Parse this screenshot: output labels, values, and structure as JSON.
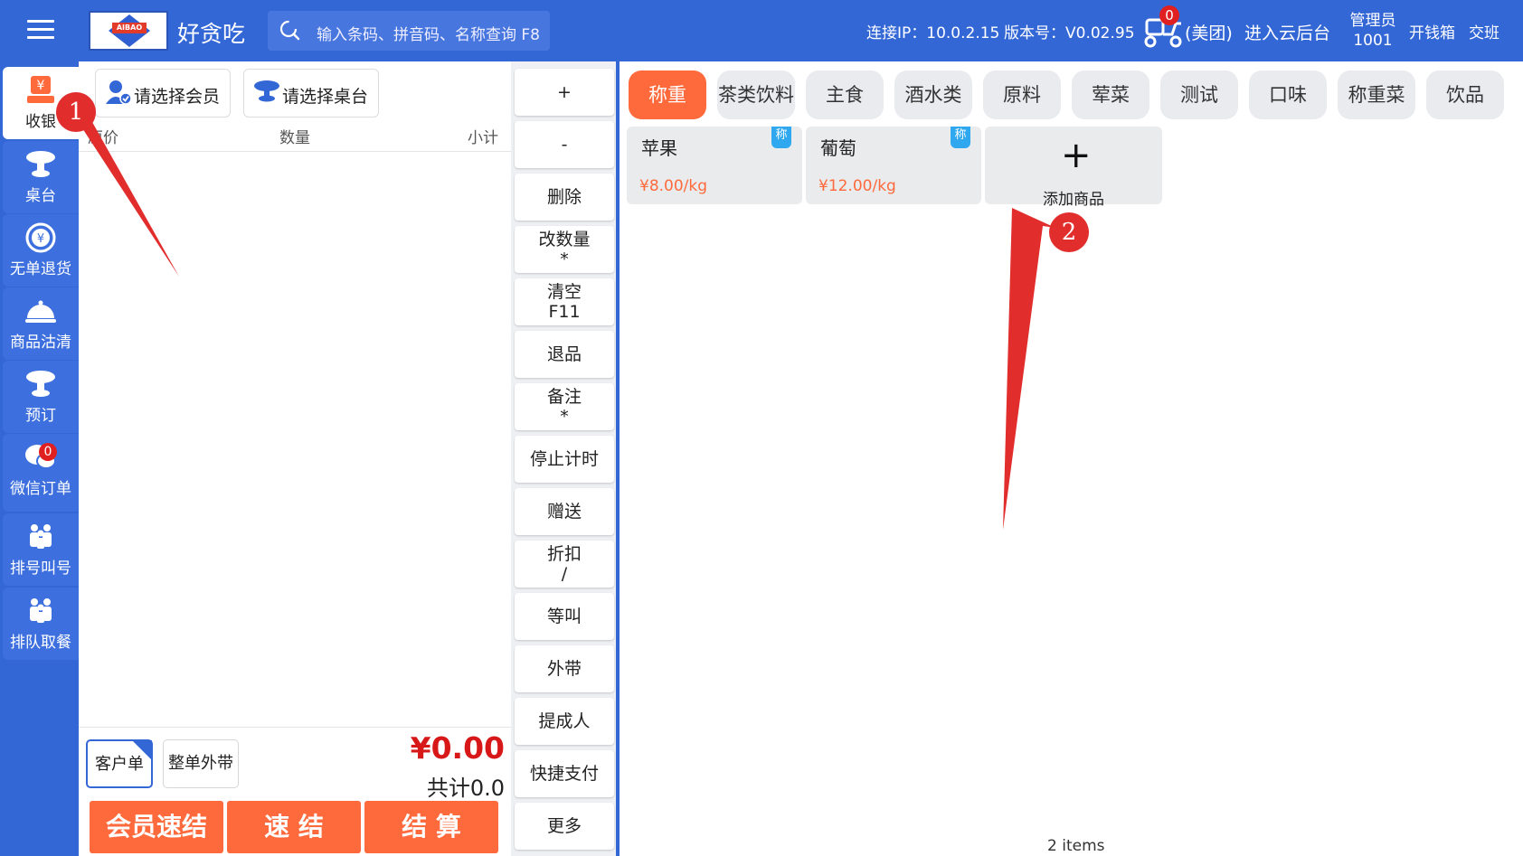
{
  "topbar": {
    "app_title": "好贪吃",
    "logo_text": "AIBAO",
    "search_placeholder": "输入条码、拼音码、名称查询 F8",
    "connection_ip": "连接IP：10.0.2.15",
    "version": "版本号：V0.02.95",
    "delivery_badge": "0",
    "delivery_platform": "(美团)",
    "cloud_backend": "进入云后台",
    "admin_role": "管理员",
    "admin_id": "1001",
    "cash_drawer": "开钱箱",
    "shift_handover": "交班"
  },
  "sidenav": {
    "items": [
      {
        "label": "收银",
        "icon": "cashier-icon"
      },
      {
        "label": "桌台",
        "icon": "table-icon"
      },
      {
        "label": "无单退货",
        "icon": "refund-icon"
      },
      {
        "label": "商品沽清",
        "icon": "cloche-icon"
      },
      {
        "label": "预订",
        "icon": "reservation-icon"
      },
      {
        "label": "微信订单",
        "icon": "wechat-icon",
        "badge": "0"
      },
      {
        "label": "排号叫号",
        "icon": "people-icon"
      },
      {
        "label": "排队取餐",
        "icon": "people-icon"
      }
    ]
  },
  "order": {
    "select_member": "请选择会员",
    "select_table": "请选择桌台",
    "columns": [
      "原价",
      "数量",
      "小计"
    ],
    "customer_order": "客户单",
    "whole_takeout": "整单外带",
    "total_amount": "¥0.00",
    "total_count": "共计0.0",
    "buttons": [
      "会员速结",
      "速 结",
      "结 算"
    ]
  },
  "functions": [
    {
      "line1": "+",
      "line2": ""
    },
    {
      "line1": "-",
      "line2": ""
    },
    {
      "line1": "删除",
      "line2": ""
    },
    {
      "line1": "改数量",
      "line2": "*"
    },
    {
      "line1": "清空",
      "line2": "F11"
    },
    {
      "line1": "退品",
      "line2": ""
    },
    {
      "line1": "备注",
      "line2": "*"
    },
    {
      "line1": "停止计时",
      "line2": ""
    },
    {
      "line1": "赠送",
      "line2": ""
    },
    {
      "line1": "折扣",
      "line2": "/"
    },
    {
      "line1": "等叫",
      "line2": ""
    },
    {
      "line1": "外带",
      "line2": ""
    },
    {
      "line1": "提成人",
      "line2": ""
    },
    {
      "line1": "快捷支付",
      "line2": ""
    },
    {
      "line1": "更多",
      "line2": ""
    }
  ],
  "categories": [
    "称重",
    "茶类饮料",
    "主食",
    "酒水类",
    "原料",
    "荤菜",
    "测试",
    "口味",
    "称重菜",
    "饮品"
  ],
  "products": [
    {
      "name": "苹果",
      "price": "¥8.00/kg",
      "badge": "称"
    },
    {
      "name": "葡萄",
      "price": "¥12.00/kg",
      "badge": "称"
    }
  ],
  "add_product_label": "添加商品",
  "add_product_symbol": "+",
  "items_count": "2 items",
  "annotations": [
    "1",
    "2"
  ],
  "colors": {
    "primary": "#3467d6",
    "accent": "#ff6a3c",
    "price_red": "#d81818",
    "badge_blue": "#2fa8f0",
    "annotation_red": "#e22d2d"
  }
}
